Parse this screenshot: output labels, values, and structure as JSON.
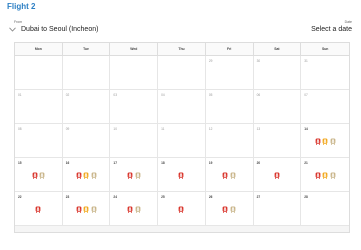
{
  "title": "Flight 2",
  "from_label": "From",
  "date_label": "Date",
  "route": "Dubai to Seoul (Incheon)",
  "date_value": "Select a date",
  "weekdays": [
    "Mon",
    "Tue",
    "Wed",
    "Thu",
    "Fri",
    "Sat",
    "Sun"
  ],
  "weeks": [
    [
      {
        "day": "",
        "icons": []
      },
      {
        "day": "",
        "icons": []
      },
      {
        "day": "",
        "icons": []
      },
      {
        "day": "",
        "icons": []
      },
      {
        "day": "29",
        "icons": [],
        "past": true
      },
      {
        "day": "30",
        "icons": [],
        "past": true
      },
      {
        "day": "31",
        "icons": [],
        "past": true
      }
    ],
    [
      {
        "day": "01",
        "icons": [],
        "past": true
      },
      {
        "day": "02",
        "icons": [],
        "past": true
      },
      {
        "day": "03",
        "icons": [],
        "past": true
      },
      {
        "day": "04",
        "icons": [],
        "past": true
      },
      {
        "day": "05",
        "icons": [],
        "past": true
      },
      {
        "day": "06",
        "icons": [],
        "past": true
      },
      {
        "day": "07",
        "icons": [],
        "past": true
      }
    ],
    [
      {
        "day": "08",
        "icons": [],
        "past": true
      },
      {
        "day": "09",
        "icons": [],
        "past": true
      },
      {
        "day": "10",
        "icons": [],
        "past": true
      },
      {
        "day": "11",
        "icons": [],
        "past": true
      },
      {
        "day": "12",
        "icons": [],
        "past": true
      },
      {
        "day": "13",
        "icons": [],
        "past": true
      },
      {
        "day": "14",
        "icons": [
          "red",
          "orange",
          "tan"
        ]
      }
    ],
    [
      {
        "day": "15",
        "icons": [
          "red",
          "tan"
        ]
      },
      {
        "day": "16",
        "icons": [
          "red",
          "orange",
          "tan"
        ]
      },
      {
        "day": "17",
        "icons": [
          "red",
          "tan"
        ]
      },
      {
        "day": "18",
        "icons": [
          "red"
        ]
      },
      {
        "day": "19",
        "icons": [
          "red",
          "tan"
        ]
      },
      {
        "day": "20",
        "icons": [
          "red"
        ]
      },
      {
        "day": "21",
        "icons": [
          "red",
          "orange",
          "tan"
        ]
      }
    ],
    [
      {
        "day": "22",
        "icons": [
          "red"
        ]
      },
      {
        "day": "23",
        "icons": [
          "red",
          "orange",
          "tan"
        ]
      },
      {
        "day": "24",
        "icons": [
          "red",
          "tan"
        ]
      },
      {
        "day": "25",
        "icons": [
          "red"
        ]
      },
      {
        "day": "26",
        "icons": [
          "red",
          "tan"
        ]
      },
      {
        "day": "27",
        "icons": []
      },
      {
        "day": "28",
        "icons": []
      }
    ]
  ],
  "icon_colors": {
    "red": "#d9342b",
    "orange": "#f2a81d",
    "tan": "#c9b58a"
  },
  "icon_names": {
    "red": "seat-red-icon",
    "orange": "seat-orange-icon",
    "tan": "seat-tan-icon"
  },
  "accent_color": "#2c7fc4"
}
